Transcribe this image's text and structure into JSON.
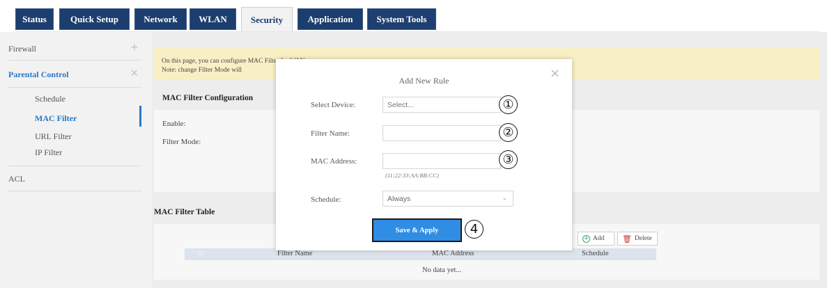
{
  "tabs": [
    {
      "label": "Status"
    },
    {
      "label": "Quick Setup"
    },
    {
      "label": "Network"
    },
    {
      "label": "WLAN"
    },
    {
      "label": "Security"
    },
    {
      "label": "Application"
    },
    {
      "label": "System Tools"
    }
  ],
  "active_tab": "Security",
  "sidebar": {
    "items": [
      {
        "label": "Firewall",
        "sign": "+"
      },
      {
        "label": "Parental Control",
        "sign": "×"
      },
      {
        "label": "ACL"
      }
    ],
    "sub_items": [
      {
        "label": "Schedule"
      },
      {
        "label": "MAC Filter"
      },
      {
        "label": "URL Filter"
      },
      {
        "label": "IP Filter"
      }
    ]
  },
  "notice": {
    "line1": "On this page, you can configure MAC Filter for WAN access.",
    "line2": "Note: change Filter Mode will"
  },
  "config": {
    "title": "MAC Filter Configuration",
    "enable_label": "Enable:",
    "mode_label": "Filter Mode:"
  },
  "table": {
    "title": "MAC Filter Table",
    "add_label": "Add",
    "delete_label": "Delete",
    "columns": [
      "ID",
      "Filter Name",
      "MAC Address",
      "Schedule"
    ],
    "empty_text": "No data yet..."
  },
  "modal": {
    "title": "Add New Rule",
    "device_label": "Select Device:",
    "device_value": "Select...",
    "name_label": "Filter Name:",
    "name_value": "",
    "mac_label": "MAC Address:",
    "mac_value": "",
    "mac_hint": "(11:22:33:AA:BB:CC)",
    "schedule_label": "Schedule:",
    "schedule_value": "Always",
    "apply_label": "Save & Apply"
  },
  "callouts": [
    "①",
    "②",
    "③",
    "4"
  ]
}
